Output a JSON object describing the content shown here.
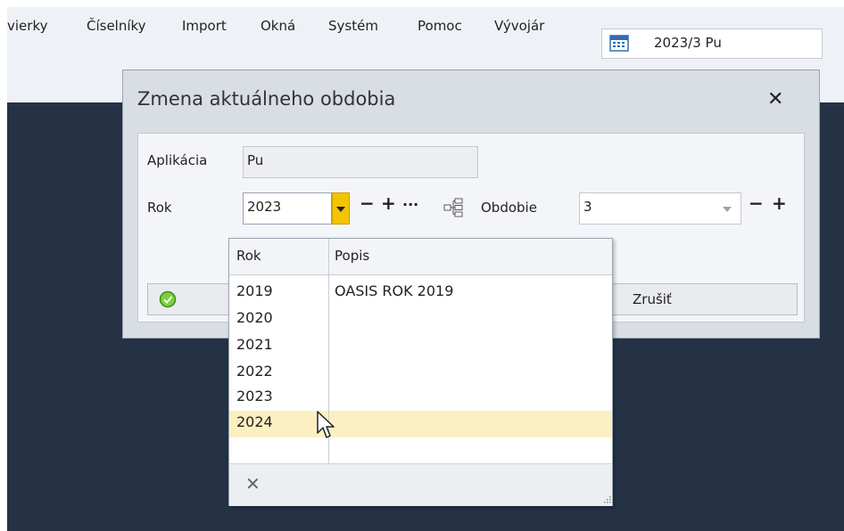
{
  "menu": {
    "items": [
      "vierky",
      "Číselníky",
      "Import",
      "Okná",
      "Systém",
      "Pomoc",
      "Vývojár"
    ]
  },
  "period_selector": {
    "icon": "calendar-icon",
    "value": "2023/3 Pu"
  },
  "dialog": {
    "title": "Zmena aktuálneho obdobia",
    "close_glyph": "✕",
    "app_label": "Aplikácia",
    "app_value": "Pu",
    "year_label": "Rok",
    "year_value": "2023",
    "minus_glyph": "−",
    "plus_glyph": "+",
    "more_glyph": "···",
    "period_label": "Obdobie",
    "period_value": "3",
    "cancel_label": "Zrušiť"
  },
  "year_popup": {
    "headers": [
      "Rok",
      "Popis"
    ],
    "rows": [
      {
        "year": "2019",
        "desc": "OASIS ROK 2019"
      },
      {
        "year": "2020",
        "desc": ""
      },
      {
        "year": "2021",
        "desc": ""
      },
      {
        "year": "2022",
        "desc": ""
      },
      {
        "year": "2023",
        "desc": ""
      },
      {
        "year": "2024",
        "desc": ""
      }
    ],
    "selected_year": "2024",
    "clear_glyph": "✕"
  },
  "colors": {
    "app_background": "#253246",
    "dropdown_button": "#f4c400",
    "selected_row": "#fcefc2"
  }
}
